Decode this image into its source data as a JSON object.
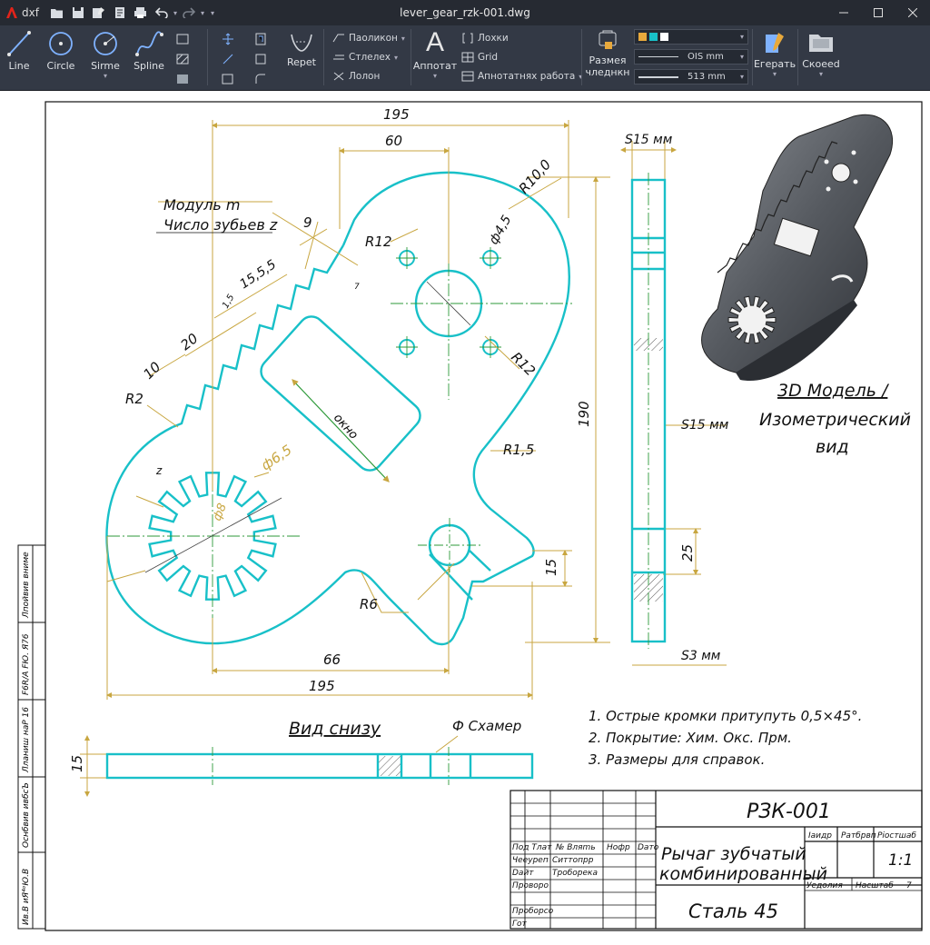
{
  "window": {
    "app_label": "dxf",
    "title": "lever_gear_rzk-001.dwg"
  },
  "ribbon": {
    "draw": {
      "line": "Line",
      "circle": "Circle",
      "sirme": "Sirme",
      "spline": "Spline"
    },
    "modify": {
      "repet": "Repet"
    },
    "layers": {
      "layer1": "Паоликон",
      "layer2": "Стлелех",
      "layer3": "Лолон"
    },
    "annot": {
      "label": "Аппотат",
      "loxki": "Лохки",
      "grid": "Grid",
      "work": "Апнотатнях работа"
    },
    "props": {
      "label1": "Размея",
      "label2": "чледнкн",
      "lw1": "OIS mm",
      "lw2": "513 mm"
    },
    "tools": {
      "egerat": "Егерать",
      "skoved": "Скоеed"
    }
  },
  "drawing": {
    "dims": {
      "d195_top": "195",
      "d60": "60",
      "d190": "190",
      "d195_bottom": "195",
      "d66": "66",
      "r10": "R10,0",
      "phi45": "ф4,5",
      "r12a": "R12",
      "r12b": "R12",
      "r15": "R1,5",
      "r2": "R2",
      "r6": "R6",
      "phi65": "ф6,5",
      "phi8": "ф8",
      "d9": "9",
      "d7": "7",
      "d155": "15,5,5",
      "d15small": "1,5",
      "d20": "20",
      "d10": "10",
      "dz": "z",
      "d15_right": "15",
      "d25": "25",
      "d15_bottom": "15"
    },
    "notes": {
      "module": "Модуль m",
      "teeth": "Число зубьев z",
      "window": "окно",
      "s15_top": "S15 мм",
      "s15_side": "S15 мм",
      "s3": "S3 мм",
      "bottom_view": "Вид снизу",
      "chamfer": "Ф Схамер",
      "iso_line1": "3D Модель /",
      "iso_line2": "Изометрический",
      "iso_line3": "вид"
    },
    "tech_notes": [
      "1. Острые кромки притупуть 0,5×45°.",
      "2. Покрытие: Хим. Окс. Прм.",
      "3. Размеры для справок."
    ],
    "side_stamps": [
      "Лпойвив вниме",
      "F6R/A FЮ. Я76",
      "Лланиш нaP 16",
      "Оснбвив ивбсЪ",
      "Ив.В иЯ⁴ᵒЮ.В"
    ]
  },
  "title_block": {
    "code": "РЗК-001",
    "name_line1": "Рычаг зубчатый",
    "name_line2": "комбинированный",
    "material": "Сталь 45",
    "col_headers": [
      "Пoд Tлат",
      "№ Вляmь",
      "Нофр",
      "Dато"
    ],
    "rows": [
      [
        "Чееуреп",
        "Ситтопрр"
      ],
      [
        "Dайт",
        "Троборека"
      ],
      [
        "Проворо",
        ""
      ],
      [
        "Проборсо",
        ""
      ],
      [
        "Гот",
        ""
      ]
    ],
    "hdr_litera": "Іаидр",
    "hdr_mass": "Ратбрвп",
    "hdr_scale": "Ріостшаб",
    "scale": "1:1",
    "sheet": "Уедолия",
    "sheets": "Насштаб",
    "sheets_num": "7"
  },
  "colors": {
    "ribbon_bg": "#333945",
    "titlebar_bg": "#262a32",
    "outline": "#18c0c8",
    "dimension": "#c8a640",
    "centerline": "#2e9a3a",
    "text": "#111111"
  }
}
